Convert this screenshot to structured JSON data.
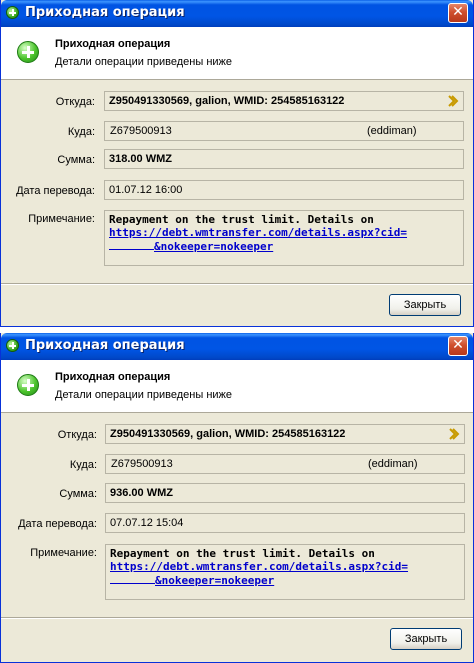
{
  "windows": [
    {
      "title": "Приходная операция",
      "close_label": "✕",
      "header_title": "Приходная операция",
      "header_subtitle": "Детали операции приведены ниже",
      "from_label": "Откуда:",
      "from_value": "Z950491330569, galion, WMID: 254585163122",
      "to_label": "Куда:",
      "to_number": "Z679500913",
      "to_name": "(eddiman)",
      "amount_label": "Сумма:",
      "amount_value": "318.00 WMZ",
      "date_label": "Дата перевода:",
      "date_value": "01.07.12 16:00",
      "note_label": "Примечание:",
      "note_line1": "Repayment on the trust limit. Details on",
      "note_link1": "https://debt.wmtransfer.com/details.aspx?cid=",
      "note_link2": "&nokeeper=nokeeper",
      "close_button": "Закрыть"
    },
    {
      "title": "Приходная операция",
      "close_label": "✕",
      "header_title": "Приходная операция",
      "header_subtitle": "Детали операции приведены ниже",
      "from_label": "Откуда:",
      "from_value": "Z950491330569, galion, WMID: 254585163122",
      "to_label": "Куда:",
      "to_number": "Z679500913",
      "to_name": "(eddiman)",
      "amount_label": "Сумма:",
      "amount_value": "936.00 WMZ",
      "date_label": "Дата перевода:",
      "date_value": "07.07.12 15:04",
      "note_label": "Примечание:",
      "note_line1": "Repayment on the trust limit. Details on",
      "note_link1": "https://debt.wmtransfer.com/details.aspx?cid=",
      "note_link2": "&nokeeper=nokeeper",
      "close_button": "Закрыть"
    }
  ],
  "icons": {
    "title": "plus-circle-icon",
    "header": "plus-circle-icon",
    "from_action": "chevron-right-icon"
  },
  "colors": {
    "titlebar": "#0054e3",
    "window_bg": "#ece9d8",
    "link": "#0000cc",
    "close_button": "#cf4f2e"
  }
}
